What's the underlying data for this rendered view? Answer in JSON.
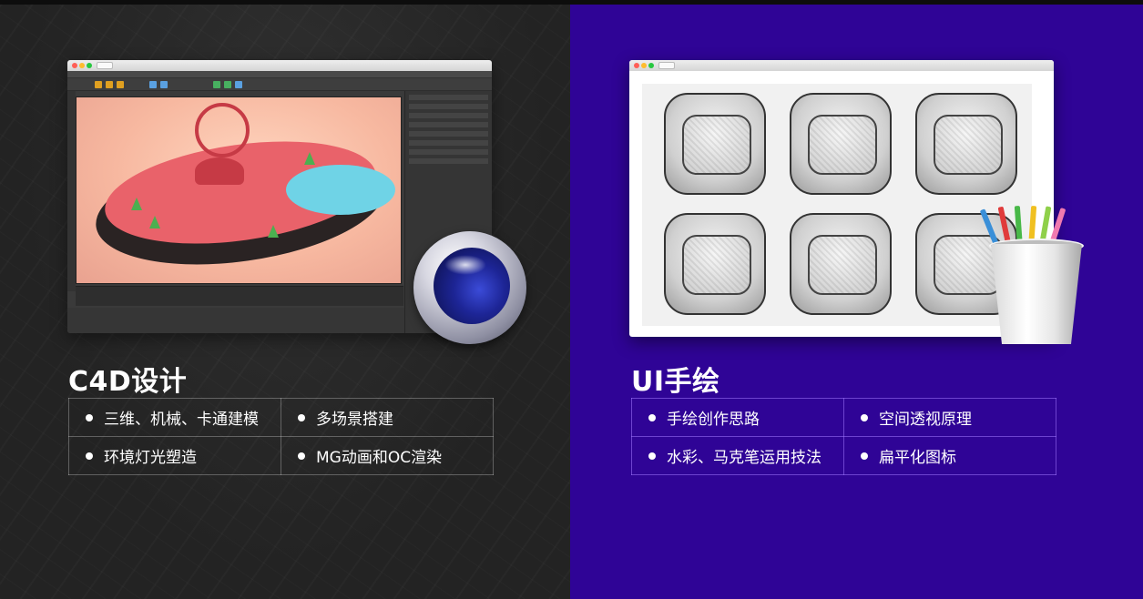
{
  "left_panel": {
    "title": "C4D设计",
    "features": [
      [
        "三维、机械、卡通建模",
        "多场景搭建"
      ],
      [
        "环境灯光塑造",
        "MG动画和OC渲染"
      ]
    ]
  },
  "right_panel": {
    "title": "UI手绘",
    "features": [
      [
        "手绘创作思路",
        "空间透视原理"
      ],
      [
        "水彩、马克笔运用技法",
        "扁平化图标"
      ]
    ]
  },
  "colors": {
    "left_bg": "#232323",
    "right_bg": "#2f0496",
    "text": "#ffffff"
  },
  "icons": [
    "cinema4d-logo-icon",
    "pencil-cup-icon"
  ]
}
